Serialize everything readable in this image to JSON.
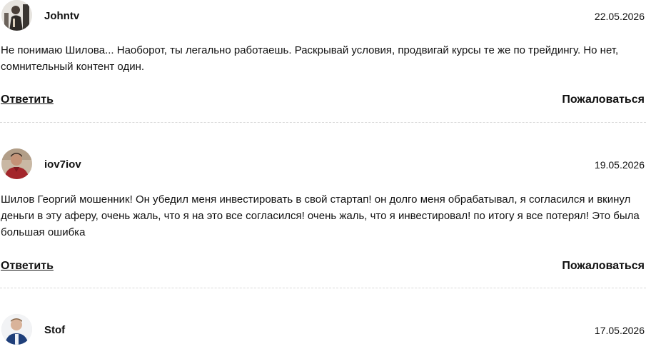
{
  "comments": [
    {
      "username": "Johntv",
      "date": "22.05.2026",
      "text": "Не понимаю Шилова... Наоборот, ты легально работаешь. Раскрывай условия, продвигай курсы те же по трейдингу. Но нет, сомнительный контент один.",
      "reply_label": "Ответить",
      "report_label": "Пожаловаться"
    },
    {
      "username": "iov7iov",
      "date": "19.05.2026",
      "text": "Шилов Георгий мошенник! Он убедил меня инвестировать в свой стартап! он долго меня обрабатывал, я согласился и вкинул деньги в эту аферу, очень жаль, что я на это все согласился! очень жаль, что я инвестировал! по итогу я все потерял! Это была большая ошибка",
      "reply_label": "Ответить",
      "report_label": "Пожаловаться"
    },
    {
      "username": "Stof",
      "date": "17.05.2026"
    }
  ]
}
